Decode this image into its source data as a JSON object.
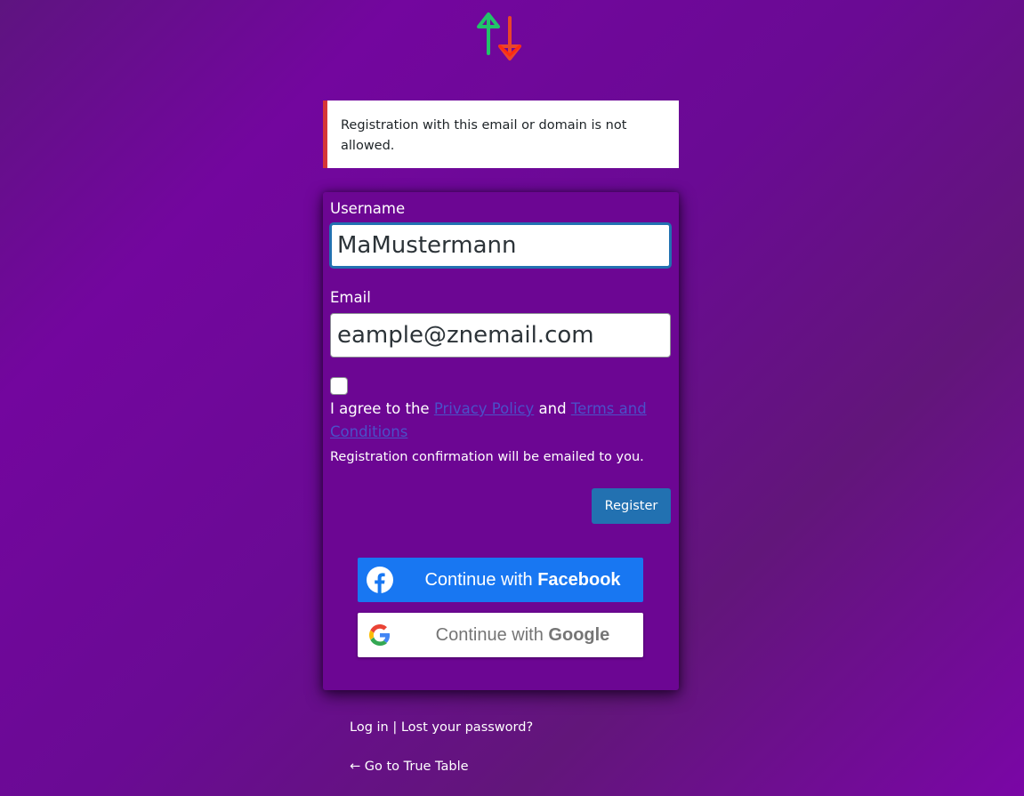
{
  "logo": {
    "icon": "up-down-arrows-logo-icon",
    "colors": {
      "up": "#22c36a",
      "down": "#e8452c"
    }
  },
  "error": {
    "message": "Registration with this email or domain is not allowed.",
    "accent": "#d63638"
  },
  "form": {
    "username_label": "Username",
    "username_value": "MaMustermann",
    "email_label": "Email",
    "email_value": "eample@znemail.com",
    "agree_prefix": "I agree to the",
    "privacy_link": "Privacy Policy",
    "agree_and": "and",
    "terms_link": "Terms and Conditions",
    "agree_checked": false,
    "confirmation_note": "Registration confirmation will be emailed to you.",
    "register_label": "Register"
  },
  "social": {
    "facebook": {
      "prefix": "Continue with",
      "brand": "Facebook",
      "icon": "facebook-icon",
      "color": "#1877f2"
    },
    "google": {
      "prefix": "Continue with",
      "brand": "Google",
      "icon": "google-icon"
    }
  },
  "footer": {
    "login_link": "Log in",
    "separator": "|",
    "lost_password_link": "Lost your password?",
    "back_link": "← Go to True Table"
  }
}
